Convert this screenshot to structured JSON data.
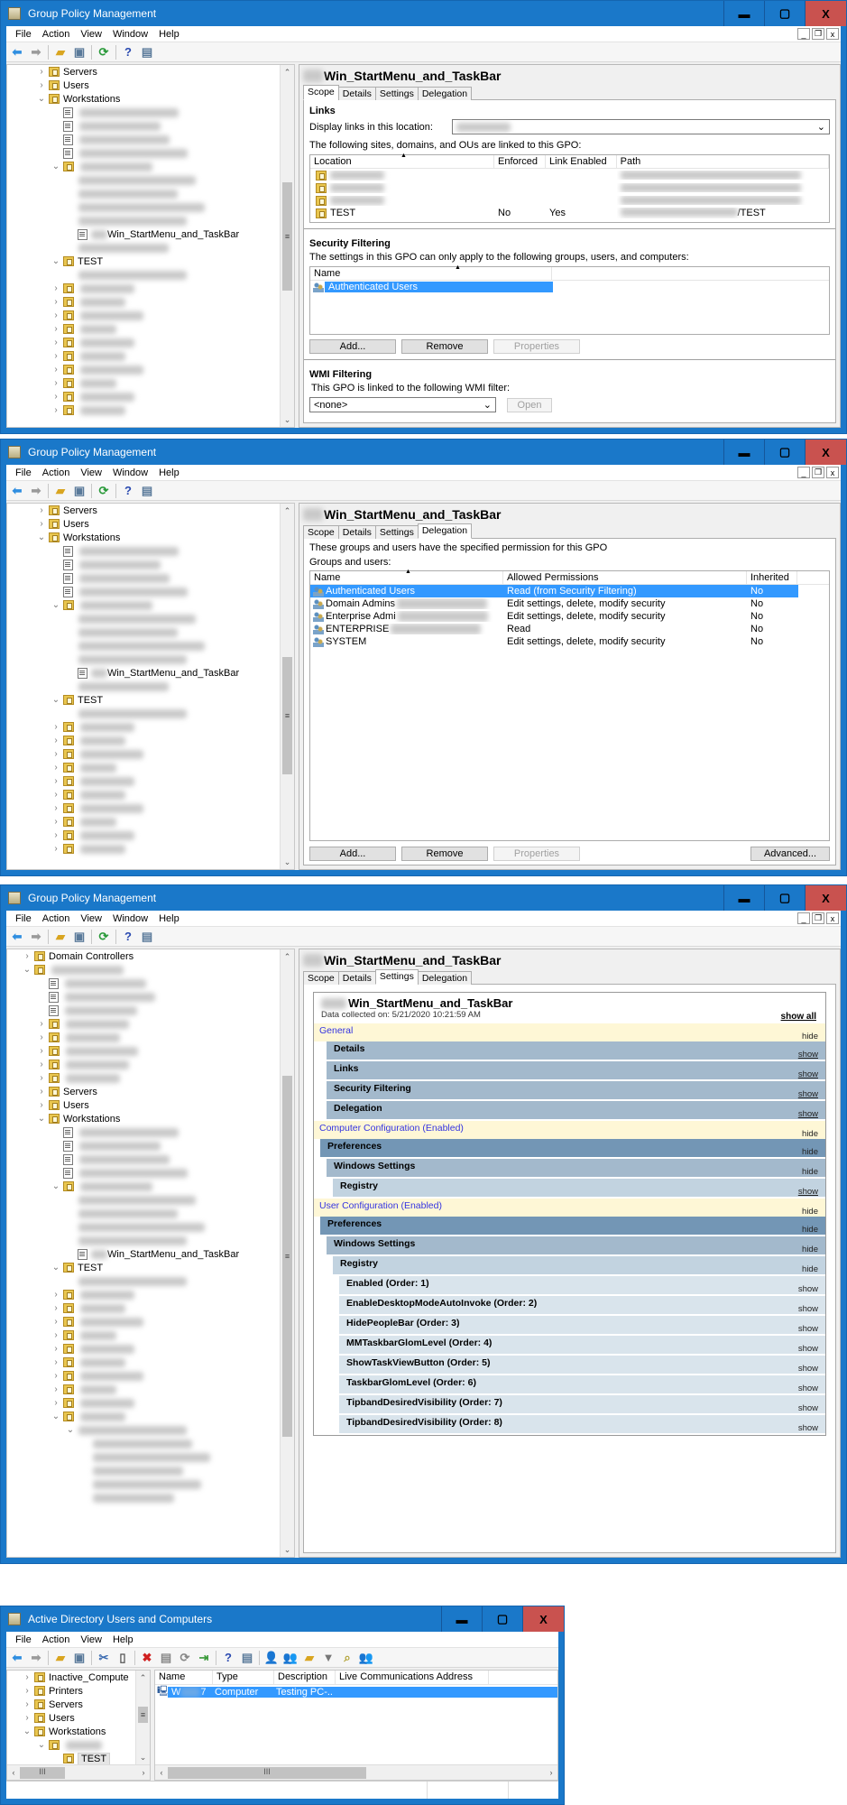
{
  "gpm": {
    "title": "Group Policy Management",
    "menu": [
      "File",
      "Action",
      "View",
      "Window",
      "Help"
    ],
    "mdi_controls": [
      "_",
      "❐",
      "x"
    ],
    "gpo_name": "Win_StartMenu_and_TaskBar",
    "tabs": [
      "Scope",
      "Details",
      "Settings",
      "Delegation"
    ]
  },
  "window_buttons": {
    "min": "▬",
    "max": "▢",
    "close": "X"
  },
  "tree1": [
    {
      "label": "Servers",
      "level": 2,
      "exp": ">",
      "icon": "folder"
    },
    {
      "label": "Users",
      "level": 2,
      "exp": ">",
      "icon": "folder"
    },
    {
      "label": "Workstations",
      "level": 2,
      "exp": "v",
      "icon": "folder"
    },
    {
      "label": "",
      "level": 3,
      "exp": "",
      "icon": "link",
      "blur": 110
    },
    {
      "label": "",
      "level": 3,
      "exp": "",
      "icon": "link",
      "blur": 90
    },
    {
      "label": "",
      "level": 3,
      "exp": "",
      "icon": "link",
      "blur": 100
    },
    {
      "label": "",
      "level": 3,
      "exp": "",
      "icon": "link",
      "blur": 120
    },
    {
      "label": "",
      "level": 3,
      "exp": "v",
      "icon": "folder",
      "blur": 80
    },
    {
      "label": "",
      "level": 4,
      "exp": "",
      "icon": "",
      "blur": 130
    },
    {
      "label": "",
      "level": 4,
      "exp": "",
      "icon": "",
      "blur": 110
    },
    {
      "label": "",
      "level": 4,
      "exp": "",
      "icon": "",
      "blur": 140
    },
    {
      "label": "",
      "level": 4,
      "exp": "",
      "icon": "",
      "blur": 120
    },
    {
      "label": "Win_StartMenu_and_TaskBar",
      "level": 4,
      "exp": "",
      "icon": "link",
      "prefix": true
    },
    {
      "label": "",
      "level": 4,
      "exp": "",
      "icon": "",
      "blur": 100
    },
    {
      "label": "TEST",
      "level": 3,
      "exp": "v",
      "icon": "folder"
    },
    {
      "label": "",
      "level": 4,
      "exp": "",
      "icon": "",
      "blur": 120
    },
    {
      "label": "",
      "level": 3,
      "exp": ">",
      "icon": "folder",
      "blur": 60
    },
    {
      "label": "",
      "level": 3,
      "exp": ">",
      "icon": "folder",
      "blur": 50
    },
    {
      "label": "",
      "level": 3,
      "exp": ">",
      "icon": "folder",
      "blur": 70
    },
    {
      "label": "",
      "level": 3,
      "exp": ">",
      "icon": "folder",
      "blur": 40
    },
    {
      "label": "",
      "level": 3,
      "exp": ">",
      "icon": "folder",
      "blur": 60
    },
    {
      "label": "",
      "level": 3,
      "exp": ">",
      "icon": "folder",
      "blur": 50
    },
    {
      "label": "",
      "level": 3,
      "exp": ">",
      "icon": "folder",
      "blur": 70
    },
    {
      "label": "",
      "level": 3,
      "exp": ">",
      "icon": "folder",
      "blur": 40
    },
    {
      "label": "",
      "level": 3,
      "exp": ">",
      "icon": "folder",
      "blur": 60
    },
    {
      "label": "",
      "level": 3,
      "exp": ">",
      "icon": "folder",
      "blur": 50
    }
  ],
  "tree3": [
    {
      "label": "Domain Controllers",
      "level": 1,
      "exp": ">",
      "icon": "folder"
    },
    {
      "label": "",
      "level": 1,
      "exp": "v",
      "icon": "folder",
      "blur": 80
    },
    {
      "label": "",
      "level": 2,
      "exp": "",
      "icon": "link",
      "blur": 90
    },
    {
      "label": "",
      "level": 2,
      "exp": "",
      "icon": "link",
      "blur": 100
    },
    {
      "label": "",
      "level": 2,
      "exp": "",
      "icon": "link",
      "blur": 80
    },
    {
      "label": "",
      "level": 2,
      "exp": ">",
      "icon": "folder",
      "blur": 70
    },
    {
      "label": "",
      "level": 2,
      "exp": ">",
      "icon": "folder",
      "blur": 60
    },
    {
      "label": "",
      "level": 2,
      "exp": ">",
      "icon": "folder",
      "blur": 80
    },
    {
      "label": "",
      "level": 2,
      "exp": ">",
      "icon": "folder",
      "blur": 70
    },
    {
      "label": "",
      "level": 2,
      "exp": ">",
      "icon": "folder",
      "blur": 60
    },
    {
      "label": "Servers",
      "level": 2,
      "exp": ">",
      "icon": "folder"
    },
    {
      "label": "Users",
      "level": 2,
      "exp": ">",
      "icon": "folder"
    },
    {
      "label": "Workstations",
      "level": 2,
      "exp": "v",
      "icon": "folder"
    },
    {
      "label": "",
      "level": 3,
      "exp": "",
      "icon": "link",
      "blur": 110
    },
    {
      "label": "",
      "level": 3,
      "exp": "",
      "icon": "link",
      "blur": 90
    },
    {
      "label": "",
      "level": 3,
      "exp": "",
      "icon": "link",
      "blur": 100
    },
    {
      "label": "",
      "level": 3,
      "exp": "",
      "icon": "link",
      "blur": 120
    },
    {
      "label": "",
      "level": 3,
      "exp": "v",
      "icon": "folder",
      "blur": 80
    },
    {
      "label": "",
      "level": 4,
      "exp": "",
      "icon": "",
      "blur": 130
    },
    {
      "label": "",
      "level": 4,
      "exp": "",
      "icon": "",
      "blur": 110
    },
    {
      "label": "",
      "level": 4,
      "exp": "",
      "icon": "",
      "blur": 140
    },
    {
      "label": "",
      "level": 4,
      "exp": "",
      "icon": "",
      "blur": 120
    },
    {
      "label": "Win_StartMenu_and_TaskBar",
      "level": 4,
      "exp": "",
      "icon": "link",
      "prefix": true
    },
    {
      "label": "TEST",
      "level": 3,
      "exp": "v",
      "icon": "folder"
    },
    {
      "label": "",
      "level": 4,
      "exp": "",
      "icon": "",
      "blur": 120
    },
    {
      "label": "",
      "level": 3,
      "exp": ">",
      "icon": "folder",
      "blur": 60
    },
    {
      "label": "",
      "level": 3,
      "exp": ">",
      "icon": "folder",
      "blur": 50
    },
    {
      "label": "",
      "level": 3,
      "exp": ">",
      "icon": "folder",
      "blur": 70
    },
    {
      "label": "",
      "level": 3,
      "exp": ">",
      "icon": "folder",
      "blur": 40
    },
    {
      "label": "",
      "level": 3,
      "exp": ">",
      "icon": "folder",
      "blur": 60
    },
    {
      "label": "",
      "level": 3,
      "exp": ">",
      "icon": "folder",
      "blur": 50
    },
    {
      "label": "",
      "level": 3,
      "exp": ">",
      "icon": "folder",
      "blur": 70
    },
    {
      "label": "",
      "level": 3,
      "exp": ">",
      "icon": "folder",
      "blur": 40
    },
    {
      "label": "",
      "level": 3,
      "exp": ">",
      "icon": "folder",
      "blur": 60
    },
    {
      "label": "",
      "level": 3,
      "exp": "v",
      "icon": "folder",
      "blur": 50
    },
    {
      "label": "",
      "level": 4,
      "exp": "v",
      "icon": "",
      "blur": 120
    },
    {
      "label": "",
      "level": 5,
      "exp": "",
      "icon": "",
      "blur": 110
    },
    {
      "label": "",
      "level": 5,
      "exp": "",
      "icon": "",
      "blur": 130
    },
    {
      "label": "",
      "level": 5,
      "exp": "",
      "icon": "",
      "blur": 100
    },
    {
      "label": "",
      "level": 5,
      "exp": "",
      "icon": "",
      "blur": 120
    },
    {
      "label": "",
      "level": 5,
      "exp": "",
      "icon": "",
      "blur": 90
    }
  ],
  "scope": {
    "links_heading": "Links",
    "display_links_label": "Display links in this location:",
    "linked_text": "The following sites, domains, and OUs are linked to this GPO:",
    "links_columns": [
      "Location",
      "Enforced",
      "Link Enabled",
      "Path"
    ],
    "links_rows": [
      {
        "location": "",
        "enforced": "",
        "enabled": "",
        "path": ""
      },
      {
        "location": "",
        "enforced": "",
        "enabled": "",
        "path": ""
      },
      {
        "location": "",
        "enforced": "",
        "enabled": "",
        "path": ""
      },
      {
        "location": "TEST",
        "enforced": "No",
        "enabled": "Yes",
        "path": "/TEST"
      }
    ],
    "security_heading": "Security Filtering",
    "security_text": "The settings in this GPO can only apply to the following groups, users, and computers:",
    "security_column": "Name",
    "security_rows": [
      "Authenticated Users"
    ],
    "buttons": {
      "add": "Add...",
      "remove": "Remove",
      "properties": "Properties"
    },
    "wmi_heading": "WMI Filtering",
    "wmi_text": "This GPO is linked to the following WMI filter:",
    "wmi_value": "<none>",
    "open_button": "Open"
  },
  "delegation": {
    "intro": "These groups and users have the specified permission for this GPO",
    "groups_label": "Groups and users:",
    "columns": [
      "Name",
      "Allowed Permissions",
      "Inherited"
    ],
    "rows": [
      {
        "name": "Authenticated Users",
        "perm": "Read (from Security Filtering)",
        "inherited": "No",
        "selected": true
      },
      {
        "name": "Domain Admins",
        "perm": "Edit settings, delete, modify security",
        "inherited": "No"
      },
      {
        "name": "Enterprise Admi",
        "perm": "Edit settings, delete, modify security",
        "inherited": "No"
      },
      {
        "name": "ENTERPRISE",
        "perm": "Read",
        "inherited": "No"
      },
      {
        "name": "SYSTEM",
        "perm": "Edit settings, delete, modify security",
        "inherited": "No"
      }
    ],
    "buttons": {
      "add": "Add...",
      "remove": "Remove",
      "properties": "Properties",
      "advanced": "Advanced..."
    }
  },
  "settings_report": {
    "title": "Win_StartMenu_and_TaskBar",
    "collected": "Data collected on: 5/21/2020 10:21:59 AM",
    "show_all": "show all",
    "rows": [
      {
        "label": "General",
        "kind": "cat",
        "action": "hide"
      },
      {
        "label": "Details",
        "kind": "ws",
        "indent": 1,
        "action": "show"
      },
      {
        "label": "Links",
        "kind": "ws",
        "indent": 1,
        "action": "show"
      },
      {
        "label": "Security Filtering",
        "kind": "ws",
        "indent": 1,
        "action": "show"
      },
      {
        "label": "Delegation",
        "kind": "ws",
        "indent": 1,
        "action": "show"
      },
      {
        "label": "Computer Configuration (Enabled)",
        "kind": "cat",
        "action": "hide"
      },
      {
        "label": "Preferences",
        "kind": "pref",
        "indent": 0.5,
        "action": "hide"
      },
      {
        "label": "Windows Settings",
        "kind": "ws",
        "indent": 1,
        "action": "hide"
      },
      {
        "label": "Registry",
        "kind": "reg",
        "indent": 1.5,
        "action": "show"
      },
      {
        "label": "User Configuration (Enabled)",
        "kind": "cat",
        "action": "hide"
      },
      {
        "label": "Preferences",
        "kind": "pref",
        "indent": 0.5,
        "action": "hide"
      },
      {
        "label": "Windows Settings",
        "kind": "ws",
        "indent": 1,
        "action": "hide"
      },
      {
        "label": "Registry",
        "kind": "reg",
        "indent": 1.5,
        "action": "hide"
      },
      {
        "label": "Enabled (Order: 1)",
        "kind": "item",
        "indent": 2,
        "action": "show"
      },
      {
        "label": "EnableDesktopModeAutoInvoke (Order: 2)",
        "kind": "item",
        "indent": 2,
        "action": "show"
      },
      {
        "label": "HidePeopleBar (Order: 3)",
        "kind": "item",
        "indent": 2,
        "action": "show"
      },
      {
        "label": "MMTaskbarGlomLevel (Order: 4)",
        "kind": "item",
        "indent": 2,
        "action": "show"
      },
      {
        "label": "ShowTaskViewButton (Order: 5)",
        "kind": "item",
        "indent": 2,
        "action": "show"
      },
      {
        "label": "TaskbarGlomLevel (Order: 6)",
        "kind": "item",
        "indent": 2,
        "action": "show"
      },
      {
        "label": "TipbandDesiredVisibility (Order: 7)",
        "kind": "item",
        "indent": 2,
        "action": "show"
      },
      {
        "label": "TipbandDesiredVisibility (Order: 8)",
        "kind": "item",
        "indent": 2,
        "action": "show"
      }
    ]
  },
  "aduc": {
    "title": "Active Directory Users and Computers",
    "menu": [
      "File",
      "Action",
      "View",
      "Help"
    ],
    "tree": [
      {
        "label": "Inactive_Compute",
        "level": 1,
        "exp": ">",
        "icon": "folder"
      },
      {
        "label": "Printers",
        "level": 1,
        "exp": ">",
        "icon": "folder"
      },
      {
        "label": "Servers",
        "level": 1,
        "exp": ">",
        "icon": "folder"
      },
      {
        "label": "Users",
        "level": 1,
        "exp": ">",
        "icon": "folder"
      },
      {
        "label": "Workstations",
        "level": 1,
        "exp": "v",
        "icon": "folder"
      },
      {
        "label": "",
        "level": 2,
        "exp": "v",
        "icon": "folder",
        "blur": 40
      },
      {
        "label": "TEST",
        "level": 3,
        "exp": "",
        "icon": "folder",
        "selected": true
      }
    ],
    "columns": [
      "Name",
      "Type",
      "Description",
      "Live Communications Address"
    ],
    "rows": [
      {
        "name_prefix": "W",
        "name_suffix": "7",
        "type": "Computer",
        "description": "Testing PC-..."
      }
    ]
  },
  "colors": {
    "titlebar": "#1a78c9",
    "close": "#c9524f",
    "selection": "#3399ff",
    "category": "#fef7d6",
    "category_text": "#3434e0"
  }
}
